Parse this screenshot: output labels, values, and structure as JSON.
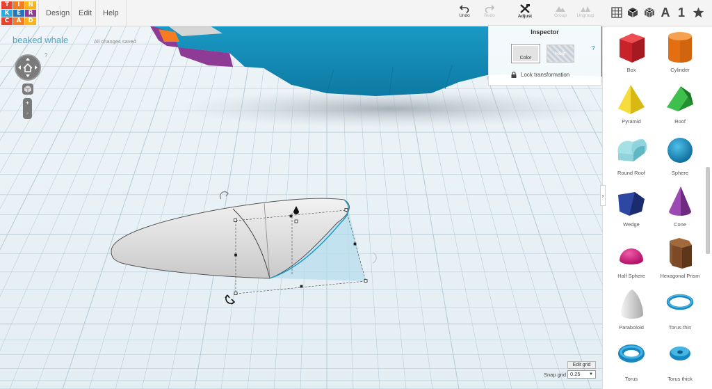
{
  "app": {
    "logo_letters": [
      "T",
      "I",
      "N",
      "K",
      "E",
      "R",
      "C",
      "A",
      "D"
    ],
    "logo_colors": [
      "#e8412d",
      "#f57c20",
      "#fbb416",
      "#27a9e1",
      "#2276bd",
      "#8e3b96",
      "#e8412d",
      "#f57c20",
      "#fbb416"
    ]
  },
  "menu": {
    "design": "Design",
    "edit": "Edit",
    "help": "Help"
  },
  "toolbar": {
    "undo": "Undo",
    "redo": "Redo",
    "adjust": "Adjust",
    "group": "Group",
    "ungroup": "Ungroup",
    "text_tool": "A",
    "number_tool": "1"
  },
  "design": {
    "title": "beaked whale",
    "save_status": "All changes saved",
    "help_mark": "?"
  },
  "inspector": {
    "title": "Inspector",
    "color_label": "Color",
    "hole_label": "Hole",
    "help": "?",
    "lock_label": "Lock transformation"
  },
  "grid": {
    "edit_label": "Edit grid",
    "snap_label": "Snap grid",
    "snap_value": "0.25"
  },
  "shapes": [
    {
      "name": "Box",
      "icon": "box-icon",
      "color": "#d62e34"
    },
    {
      "name": "Cylinder",
      "icon": "cylinder-icon",
      "color": "#ee7a1c"
    },
    {
      "name": "Pyramid",
      "icon": "pyramid-icon",
      "color": "#f3d11d"
    },
    {
      "name": "Roof",
      "icon": "roof-icon",
      "color": "#31a83d"
    },
    {
      "name": "Round Roof",
      "icon": "round-roof-icon",
      "color": "#79cbd5"
    },
    {
      "name": "Sphere",
      "icon": "sphere-icon",
      "color": "#1f92cf"
    },
    {
      "name": "Wedge",
      "icon": "wedge-icon",
      "color": "#22388a"
    },
    {
      "name": "Cone",
      "icon": "cone-icon",
      "color": "#8d3ea1"
    },
    {
      "name": "Half Sphere",
      "icon": "half-sphere-icon",
      "color": "#e0218a"
    },
    {
      "name": "Hexagonal Prism",
      "icon": "hexagonal-prism-icon",
      "color": "#7c4a26"
    },
    {
      "name": "Paraboloid",
      "icon": "paraboloid-icon",
      "color": "#d8d8d8"
    },
    {
      "name": "Torus thin",
      "icon": "torus-thin-icon",
      "color": "#1f92cf"
    },
    {
      "name": "Torus",
      "icon": "torus-icon",
      "color": "#1f92cf"
    },
    {
      "name": "Torus thick",
      "icon": "torus-thick-icon",
      "color": "#1f92cf"
    }
  ]
}
